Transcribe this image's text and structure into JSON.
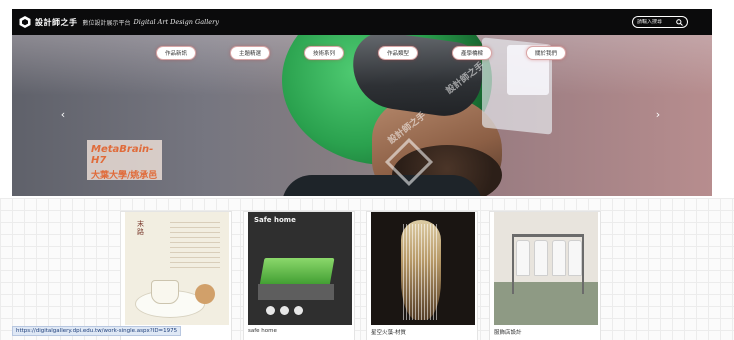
{
  "header": {
    "brand_name": "設計師之手",
    "brand_sub": "數位設計展示平台",
    "brand_en": "Digital Art Design Gallery",
    "search_placeholder": "請輸入搜尋"
  },
  "hero": {
    "categories": [
      "作品新訊",
      "主題精選",
      "技術系列",
      "作品類型",
      "產學橋樑",
      "關於我們"
    ],
    "caption_title": "MetaBrain-H7",
    "caption_sub": "大葉大學/姚承邑",
    "watermark_text": "設計師之手"
  },
  "cards": [
    {
      "title": ""
    },
    {
      "title": "safe home",
      "image_heading": "Safe home"
    },
    {
      "title": "星空火藻-材質"
    },
    {
      "title": "服飾店設計"
    }
  ],
  "card1_heading": "末路",
  "status_url": "https://digitalgallery.dpi.edu.tw/work-single.aspx?ID=1975",
  "colors": {
    "topbar": "#0b0b0c",
    "caption_text": "#e06b3a",
    "helmet_green": "#2aa14e"
  }
}
